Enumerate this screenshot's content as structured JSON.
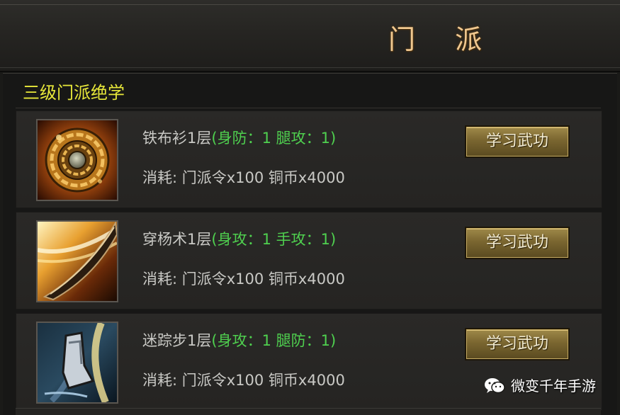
{
  "window": {
    "title": "门 派"
  },
  "section": {
    "title": "三级门派绝学"
  },
  "skills": [
    {
      "name": "铁布衫1层",
      "stats": "(身防：1 腿攻：1)",
      "cost": "消耗: 门派令x100 铜币x4000",
      "button": "学习武功",
      "icon": "golden-disc-icon"
    },
    {
      "name": "穿杨术1层",
      "stats": "(身攻：1 手攻：1)",
      "cost": "消耗: 门派令x100 铜币x4000",
      "button": "学习武功",
      "icon": "blade-slash-icon"
    },
    {
      "name": "迷踪步1层",
      "stats": "(身攻：1 腿防：1)",
      "cost": "消耗: 门派令x100 铜币x4000",
      "button": "学习武功",
      "icon": "boot-swirl-icon"
    }
  ],
  "watermark": {
    "text": "微变千年手游",
    "icon": "wechat-icon"
  },
  "colors": {
    "title": "#f0c890",
    "section_title": "#e8e83a",
    "stats_green": "#4fd04f",
    "text_gray": "#c9c9c5",
    "button_gold": "#7a6630"
  }
}
